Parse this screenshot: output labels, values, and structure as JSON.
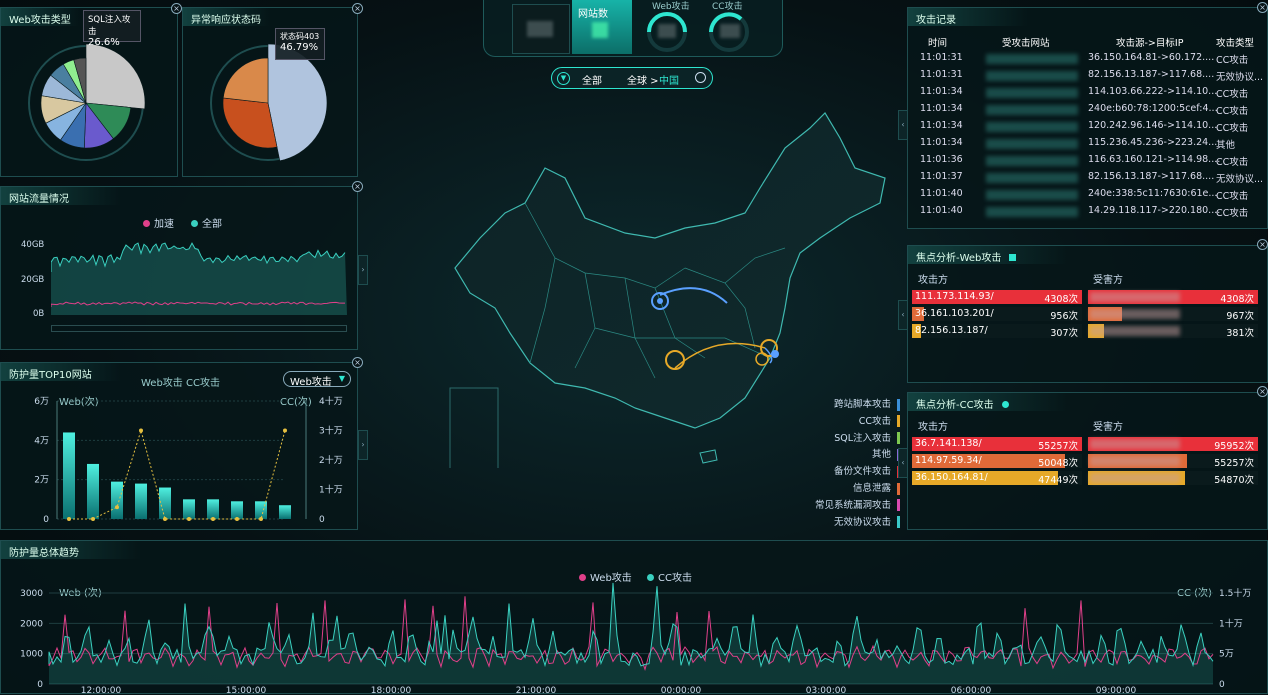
{
  "top_nav": {
    "site_count_label": "网站数",
    "web_attack_label": "Web攻击",
    "cc_attack_label": "CC攻击"
  },
  "region": {
    "all": "全部",
    "global": "全球 >",
    "china": "中国"
  },
  "web_type": {
    "title": "Web攻击类型",
    "tooltip_name": "SQL注入攻击",
    "tooltip_pct": "26.6%",
    "slices": [
      {
        "value": 26.6,
        "color": "#c8c8c8"
      },
      {
        "value": 13,
        "color": "#2e8b57"
      },
      {
        "value": 11,
        "color": "#6a5acd"
      },
      {
        "value": 9,
        "color": "#3a6fb0"
      },
      {
        "value": 8,
        "color": "#87b4e0"
      },
      {
        "value": 10,
        "color": "#d8c8a0"
      },
      {
        "value": 8,
        "color": "#9cb8d8"
      },
      {
        "value": 6,
        "color": "#4a7fa0"
      },
      {
        "value": 4,
        "color": "#90ee90"
      },
      {
        "value": 4.4,
        "color": "#555"
      }
    ]
  },
  "status_code": {
    "title": "异常响应状态码",
    "tooltip_name": "状态码403",
    "tooltip_pct": "46.79%",
    "slices": [
      {
        "value": 46.79,
        "color": "#b0c4de"
      },
      {
        "value": 30,
        "color": "#c8501e"
      },
      {
        "value": 23.21,
        "color": "#d9894a"
      }
    ]
  },
  "traffic": {
    "title": "网站流量情况",
    "legend_accel": "加速",
    "legend_all": "全部",
    "y_ticks": [
      "40GB",
      "20GB",
      "0B"
    ]
  },
  "top10": {
    "title": "防护量TOP10网站",
    "tab_web": "Web攻击",
    "tab_cc": "CC攻击",
    "select_value": "Web攻击",
    "left_axis_title": "Web(次)",
    "right_axis_title": "CC(次)",
    "left_ticks": [
      "6万",
      "4万",
      "2万",
      "0"
    ],
    "right_ticks": [
      "4十万",
      "3十万",
      "2十万",
      "1十万",
      "0"
    ],
    "bars": [
      4.4,
      2.8,
      1.9,
      1.8,
      1.6,
      1.0,
      1.0,
      0.9,
      0.9,
      0.7
    ],
    "cc_line": [
      0,
      0,
      0.4,
      3.0,
      0,
      0,
      0,
      0,
      0,
      3.0
    ]
  },
  "attack_log": {
    "title": "攻击记录",
    "headers": [
      "时间",
      "受攻击网站",
      "攻击源->目标IP",
      "攻击类型"
    ],
    "rows": [
      {
        "time": "11:01:31",
        "ip": "36.150.164.81->60.172....",
        "type": "CC攻击"
      },
      {
        "time": "11:01:31",
        "ip": "82.156.13.187->117.68....",
        "type": "无效协议..."
      },
      {
        "time": "11:01:34",
        "ip": "114.103.66.222->114.10...",
        "type": "CC攻击"
      },
      {
        "time": "11:01:34",
        "ip": "240e:b60:78:1200:5cef:4...",
        "type": "CC攻击"
      },
      {
        "time": "11:01:34",
        "ip": "120.242.96.146->114.10...",
        "type": "CC攻击"
      },
      {
        "time": "11:01:34",
        "ip": "115.236.45.236->223.24...",
        "type": "其他"
      },
      {
        "time": "11:01:36",
        "ip": "116.63.160.121->114.98....",
        "type": "CC攻击"
      },
      {
        "time": "11:01:37",
        "ip": "82.156.13.187->117.68....",
        "type": "无效协议..."
      },
      {
        "time": "11:01:40",
        "ip": "240e:338:5c11:7630:61e...",
        "type": "CC攻击"
      },
      {
        "time": "11:01:40",
        "ip": "14.29.118.117->220.180....",
        "type": "CC攻击"
      }
    ]
  },
  "focus_web": {
    "title": "焦点分析-Web攻击",
    "attacker_label": "攻击方",
    "victim_label": "受害方",
    "attackers": [
      {
        "ip": "111.173.114.93/",
        "count": "4308次",
        "color": "#e8303a",
        "frac": 1.0
      },
      {
        "ip": "36.161.103.201/",
        "count": "956次",
        "color": "#e06a38",
        "frac": 0.07
      },
      {
        "ip": "82.156.13.187/",
        "count": "307次",
        "color": "#e6a928",
        "frac": 0.05
      }
    ],
    "victims": [
      {
        "count": "4308次",
        "color": "#e8303a",
        "frac": 1.0
      },
      {
        "count": "967次",
        "color": "#e06a38",
        "frac": 0.2
      },
      {
        "count": "381次",
        "color": "#e6a928",
        "frac": 0.09
      }
    ]
  },
  "focus_cc": {
    "title": "焦点分析-CC攻击",
    "attacker_label": "攻击方",
    "victim_label": "受害方",
    "attackers": [
      {
        "ip": "36.7.141.138/",
        "count": "55257次",
        "color": "#e8303a",
        "frac": 1.0
      },
      {
        "ip": "114.97.59.34/",
        "count": "50048次",
        "color": "#e06a38",
        "frac": 0.9
      },
      {
        "ip": "36.150.164.81/",
        "count": "47449次",
        "color": "#e6a928",
        "frac": 0.86
      }
    ],
    "victims": [
      {
        "count": "95952次",
        "color": "#e8303a",
        "frac": 1.0
      },
      {
        "count": "55257次",
        "color": "#e06a38",
        "frac": 0.58
      },
      {
        "count": "54870次",
        "color": "#e6a928",
        "frac": 0.57
      }
    ]
  },
  "map_legend": [
    {
      "label": "跨站脚本攻击",
      "color": "#3a8fd8"
    },
    {
      "label": "CC攻击",
      "color": "#e6a928"
    },
    {
      "label": "SQL注入攻击",
      "color": "#7ec850"
    },
    {
      "label": "其他",
      "color": "#8a6ad8"
    },
    {
      "label": "备份文件攻击",
      "color": "#e8303a"
    },
    {
      "label": "信息泄露",
      "color": "#e06a38"
    },
    {
      "label": "常见系统漏洞攻击",
      "color": "#d84ab0"
    },
    {
      "label": "无效协议攻击",
      "color": "#3ac8c8"
    }
  ],
  "trend": {
    "title": "防护量总体趋势",
    "legend_web": "Web攻击",
    "legend_cc": "CC攻击",
    "left_axis_title": "Web (次)",
    "right_axis_title": "CC (次)",
    "left_ticks": [
      "3000",
      "2000",
      "1000",
      "0"
    ],
    "right_ticks": [
      "1.5十万",
      "1十万",
      "5万",
      "0"
    ],
    "x_ticks": [
      "12:00:00",
      "15:00:00",
      "18:00:00",
      "21:00:00",
      "00:00:00",
      "03:00:00",
      "06:00:00",
      "09:00:00"
    ]
  },
  "colors": {
    "accent": "#2ee6d0",
    "web": "#e0408a",
    "cc": "#3ad0c0",
    "border": "#1e4d4f"
  }
}
